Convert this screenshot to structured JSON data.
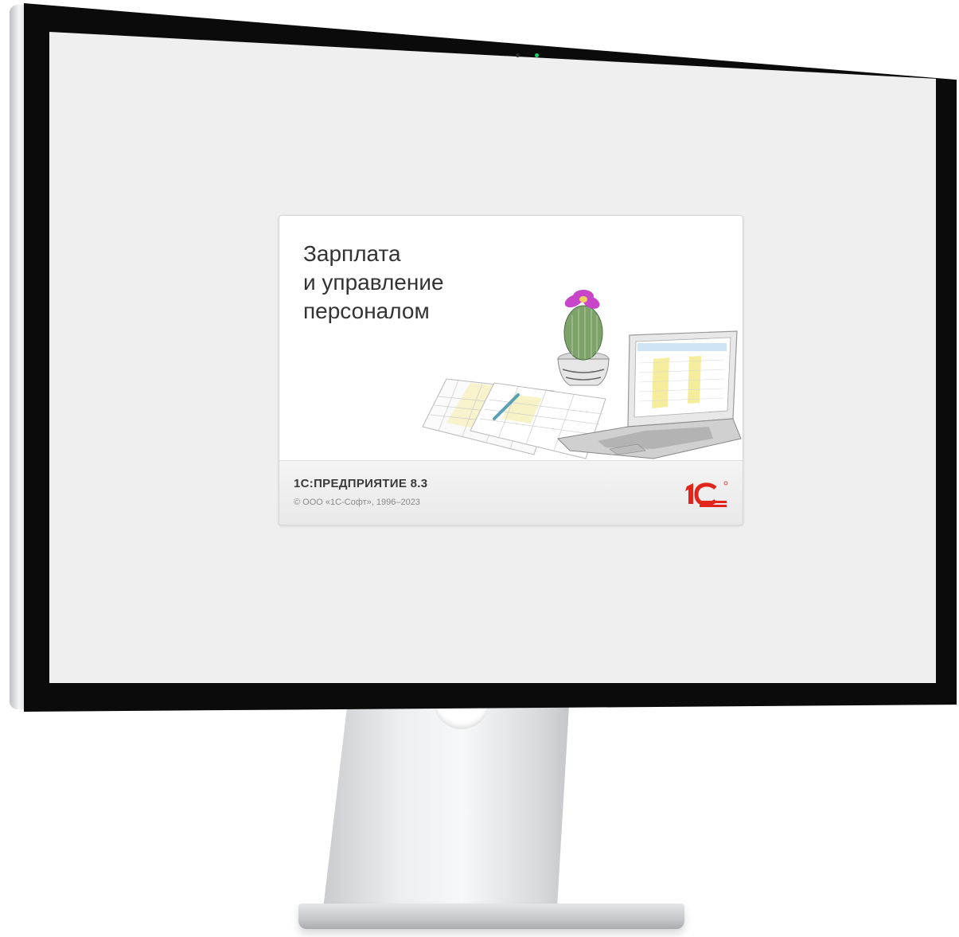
{
  "splash": {
    "title_lines": [
      "Зарплата",
      "и управление",
      "персоналом"
    ],
    "platform": "1С:ПРЕДПРИЯТИЕ 8.3",
    "copyright": "© ООО «1С-Софт», 1996–2023",
    "logo_text": "1С"
  },
  "colors": {
    "screen_bg": "#efefef",
    "logo_red": "#e1251b",
    "title_text": "#333333",
    "camera_led": "#1fd16a"
  },
  "icons": {
    "logo": "1c-logo",
    "illustration": "cactus-laptop-documents-illustration"
  }
}
